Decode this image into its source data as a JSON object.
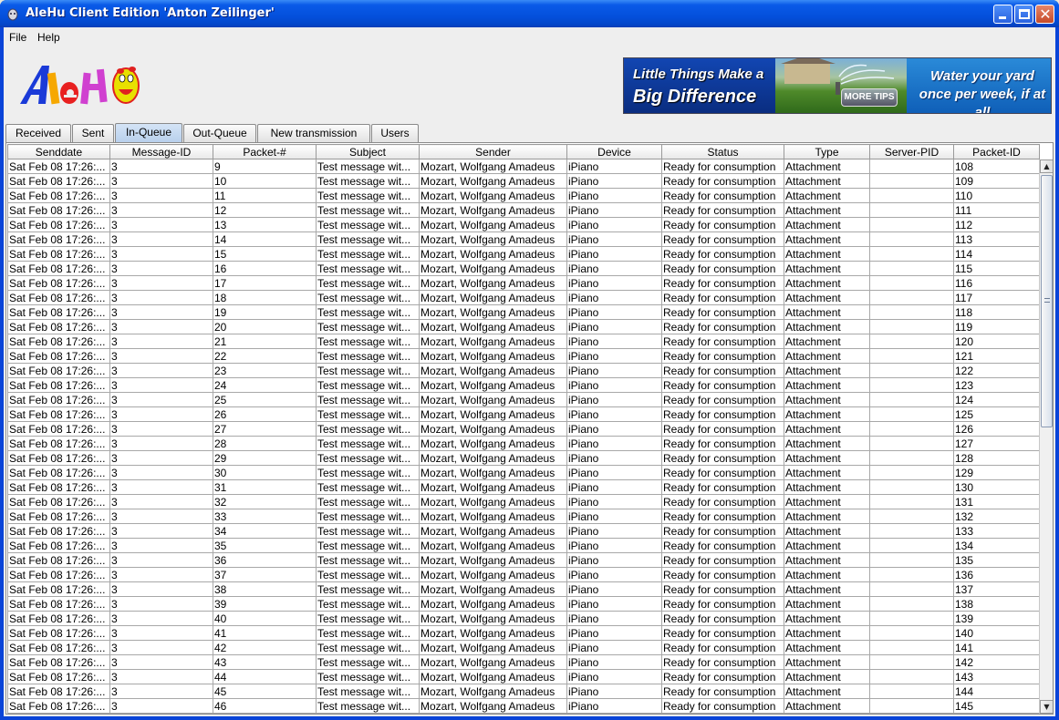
{
  "window": {
    "title": "AleHu Client Edition 'Anton Zeilinger'",
    "accent_color": "#0a5ae8"
  },
  "menu": {
    "file": "File",
    "help": "Help"
  },
  "logo": {
    "text": "AleHu"
  },
  "banner": {
    "line1": "Little Things Make a",
    "line2": "Big Difference",
    "button": "MORE TIPS",
    "line3": "Water your yard once per week, if at all"
  },
  "tabs": [
    {
      "label": "Received"
    },
    {
      "label": "Sent"
    },
    {
      "label": "In-Queue",
      "active": true
    },
    {
      "label": "Out-Queue"
    },
    {
      "label": "New transmission"
    },
    {
      "label": "Users"
    }
  ],
  "table": {
    "columns": [
      "Senddate",
      "Message-ID",
      "Packet-#",
      "Subject",
      "Sender",
      "Device",
      "Status",
      "Type",
      "Server-PID",
      "Packet-ID"
    ],
    "rows": [
      [
        "Sat Feb 08 17:26:...",
        "3",
        "9",
        "Test message wit...",
        "Mozart, Wolfgang Amadeus",
        "iPiano",
        "Ready for consumption",
        "Attachment",
        "",
        "108"
      ],
      [
        "Sat Feb 08 17:26:...",
        "3",
        "10",
        "Test message wit...",
        "Mozart, Wolfgang Amadeus",
        "iPiano",
        "Ready for consumption",
        "Attachment",
        "",
        "109"
      ],
      [
        "Sat Feb 08 17:26:...",
        "3",
        "11",
        "Test message wit...",
        "Mozart, Wolfgang Amadeus",
        "iPiano",
        "Ready for consumption",
        "Attachment",
        "",
        "110"
      ],
      [
        "Sat Feb 08 17:26:...",
        "3",
        "12",
        "Test message wit...",
        "Mozart, Wolfgang Amadeus",
        "iPiano",
        "Ready for consumption",
        "Attachment",
        "",
        "111"
      ],
      [
        "Sat Feb 08 17:26:...",
        "3",
        "13",
        "Test message wit...",
        "Mozart, Wolfgang Amadeus",
        "iPiano",
        "Ready for consumption",
        "Attachment",
        "",
        "112"
      ],
      [
        "Sat Feb 08 17:26:...",
        "3",
        "14",
        "Test message wit...",
        "Mozart, Wolfgang Amadeus",
        "iPiano",
        "Ready for consumption",
        "Attachment",
        "",
        "113"
      ],
      [
        "Sat Feb 08 17:26:...",
        "3",
        "15",
        "Test message wit...",
        "Mozart, Wolfgang Amadeus",
        "iPiano",
        "Ready for consumption",
        "Attachment",
        "",
        "114"
      ],
      [
        "Sat Feb 08 17:26:...",
        "3",
        "16",
        "Test message wit...",
        "Mozart, Wolfgang Amadeus",
        "iPiano",
        "Ready for consumption",
        "Attachment",
        "",
        "115"
      ],
      [
        "Sat Feb 08 17:26:...",
        "3",
        "17",
        "Test message wit...",
        "Mozart, Wolfgang Amadeus",
        "iPiano",
        "Ready for consumption",
        "Attachment",
        "",
        "116"
      ],
      [
        "Sat Feb 08 17:26:...",
        "3",
        "18",
        "Test message wit...",
        "Mozart, Wolfgang Amadeus",
        "iPiano",
        "Ready for consumption",
        "Attachment",
        "",
        "117"
      ],
      [
        "Sat Feb 08 17:26:...",
        "3",
        "19",
        "Test message wit...",
        "Mozart, Wolfgang Amadeus",
        "iPiano",
        "Ready for consumption",
        "Attachment",
        "",
        "118"
      ],
      [
        "Sat Feb 08 17:26:...",
        "3",
        "20",
        "Test message wit...",
        "Mozart, Wolfgang Amadeus",
        "iPiano",
        "Ready for consumption",
        "Attachment",
        "",
        "119"
      ],
      [
        "Sat Feb 08 17:26:...",
        "3",
        "21",
        "Test message wit...",
        "Mozart, Wolfgang Amadeus",
        "iPiano",
        "Ready for consumption",
        "Attachment",
        "",
        "120"
      ],
      [
        "Sat Feb 08 17:26:...",
        "3",
        "22",
        "Test message wit...",
        "Mozart, Wolfgang Amadeus",
        "iPiano",
        "Ready for consumption",
        "Attachment",
        "",
        "121"
      ],
      [
        "Sat Feb 08 17:26:...",
        "3",
        "23",
        "Test message wit...",
        "Mozart, Wolfgang Amadeus",
        "iPiano",
        "Ready for consumption",
        "Attachment",
        "",
        "122"
      ],
      [
        "Sat Feb 08 17:26:...",
        "3",
        "24",
        "Test message wit...",
        "Mozart, Wolfgang Amadeus",
        "iPiano",
        "Ready for consumption",
        "Attachment",
        "",
        "123"
      ],
      [
        "Sat Feb 08 17:26:...",
        "3",
        "25",
        "Test message wit...",
        "Mozart, Wolfgang Amadeus",
        "iPiano",
        "Ready for consumption",
        "Attachment",
        "",
        "124"
      ],
      [
        "Sat Feb 08 17:26:...",
        "3",
        "26",
        "Test message wit...",
        "Mozart, Wolfgang Amadeus",
        "iPiano",
        "Ready for consumption",
        "Attachment",
        "",
        "125"
      ],
      [
        "Sat Feb 08 17:26:...",
        "3",
        "27",
        "Test message wit...",
        "Mozart, Wolfgang Amadeus",
        "iPiano",
        "Ready for consumption",
        "Attachment",
        "",
        "126"
      ],
      [
        "Sat Feb 08 17:26:...",
        "3",
        "28",
        "Test message wit...",
        "Mozart, Wolfgang Amadeus",
        "iPiano",
        "Ready for consumption",
        "Attachment",
        "",
        "127"
      ],
      [
        "Sat Feb 08 17:26:...",
        "3",
        "29",
        "Test message wit...",
        "Mozart, Wolfgang Amadeus",
        "iPiano",
        "Ready for consumption",
        "Attachment",
        "",
        "128"
      ],
      [
        "Sat Feb 08 17:26:...",
        "3",
        "30",
        "Test message wit...",
        "Mozart, Wolfgang Amadeus",
        "iPiano",
        "Ready for consumption",
        "Attachment",
        "",
        "129"
      ],
      [
        "Sat Feb 08 17:26:...",
        "3",
        "31",
        "Test message wit...",
        "Mozart, Wolfgang Amadeus",
        "iPiano",
        "Ready for consumption",
        "Attachment",
        "",
        "130"
      ],
      [
        "Sat Feb 08 17:26:...",
        "3",
        "32",
        "Test message wit...",
        "Mozart, Wolfgang Amadeus",
        "iPiano",
        "Ready for consumption",
        "Attachment",
        "",
        "131"
      ],
      [
        "Sat Feb 08 17:26:...",
        "3",
        "33",
        "Test message wit...",
        "Mozart, Wolfgang Amadeus",
        "iPiano",
        "Ready for consumption",
        "Attachment",
        "",
        "132"
      ],
      [
        "Sat Feb 08 17:26:...",
        "3",
        "34",
        "Test message wit...",
        "Mozart, Wolfgang Amadeus",
        "iPiano",
        "Ready for consumption",
        "Attachment",
        "",
        "133"
      ],
      [
        "Sat Feb 08 17:26:...",
        "3",
        "35",
        "Test message wit...",
        "Mozart, Wolfgang Amadeus",
        "iPiano",
        "Ready for consumption",
        "Attachment",
        "",
        "134"
      ],
      [
        "Sat Feb 08 17:26:...",
        "3",
        "36",
        "Test message wit...",
        "Mozart, Wolfgang Amadeus",
        "iPiano",
        "Ready for consumption",
        "Attachment",
        "",
        "135"
      ],
      [
        "Sat Feb 08 17:26:...",
        "3",
        "37",
        "Test message wit...",
        "Mozart, Wolfgang Amadeus",
        "iPiano",
        "Ready for consumption",
        "Attachment",
        "",
        "136"
      ],
      [
        "Sat Feb 08 17:26:...",
        "3",
        "38",
        "Test message wit...",
        "Mozart, Wolfgang Amadeus",
        "iPiano",
        "Ready for consumption",
        "Attachment",
        "",
        "137"
      ],
      [
        "Sat Feb 08 17:26:...",
        "3",
        "39",
        "Test message wit...",
        "Mozart, Wolfgang Amadeus",
        "iPiano",
        "Ready for consumption",
        "Attachment",
        "",
        "138"
      ],
      [
        "Sat Feb 08 17:26:...",
        "3",
        "40",
        "Test message wit...",
        "Mozart, Wolfgang Amadeus",
        "iPiano",
        "Ready for consumption",
        "Attachment",
        "",
        "139"
      ],
      [
        "Sat Feb 08 17:26:...",
        "3",
        "41",
        "Test message wit...",
        "Mozart, Wolfgang Amadeus",
        "iPiano",
        "Ready for consumption",
        "Attachment",
        "",
        "140"
      ],
      [
        "Sat Feb 08 17:26:...",
        "3",
        "42",
        "Test message wit...",
        "Mozart, Wolfgang Amadeus",
        "iPiano",
        "Ready for consumption",
        "Attachment",
        "",
        "141"
      ],
      [
        "Sat Feb 08 17:26:...",
        "3",
        "43",
        "Test message wit...",
        "Mozart, Wolfgang Amadeus",
        "iPiano",
        "Ready for consumption",
        "Attachment",
        "",
        "142"
      ],
      [
        "Sat Feb 08 17:26:...",
        "3",
        "44",
        "Test message wit...",
        "Mozart, Wolfgang Amadeus",
        "iPiano",
        "Ready for consumption",
        "Attachment",
        "",
        "143"
      ],
      [
        "Sat Feb 08 17:26:...",
        "3",
        "45",
        "Test message wit...",
        "Mozart, Wolfgang Amadeus",
        "iPiano",
        "Ready for consumption",
        "Attachment",
        "",
        "144"
      ],
      [
        "Sat Feb 08 17:26:...",
        "3",
        "46",
        "Test message wit...",
        "Mozart, Wolfgang Amadeus",
        "iPiano",
        "Ready for consumption",
        "Attachment",
        "",
        "145"
      ]
    ]
  },
  "scrollbar": {
    "up_icon": "arrow-up-icon",
    "down_icon": "arrow-down-icon"
  }
}
